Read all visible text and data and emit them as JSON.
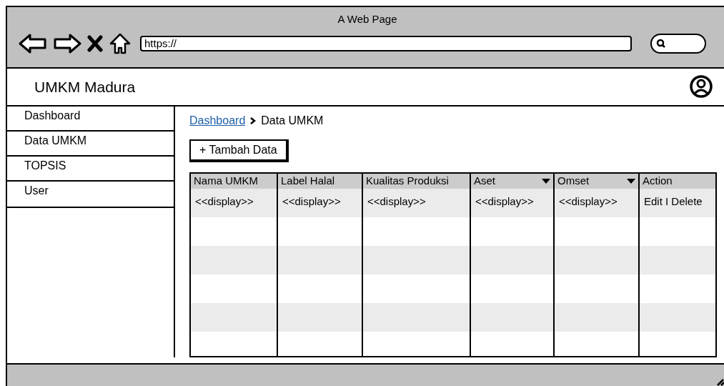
{
  "window": {
    "title": "A Web Page",
    "url": "https://"
  },
  "header": {
    "title": "UMKM Madura"
  },
  "sidebar": {
    "items": [
      {
        "label": "Dashboard"
      },
      {
        "label": "Data UMKM"
      },
      {
        "label": "TOPSIS"
      },
      {
        "label": "User"
      }
    ]
  },
  "breadcrumb": {
    "link": "Dashboard",
    "current": "Data UMKM"
  },
  "add_button": "+ Tambah Data",
  "table": {
    "columns": [
      {
        "label": "Nama UMKM",
        "kind": "text"
      },
      {
        "label": "Label Halal",
        "kind": "text"
      },
      {
        "label": "Kualitas Produksi",
        "kind": "text"
      },
      {
        "label": "Aset",
        "kind": "dropdown"
      },
      {
        "label": "Omset",
        "kind": "dropdown"
      },
      {
        "label": "Action",
        "kind": "text"
      }
    ],
    "rows": [
      [
        "<<display>>",
        "<<display>>",
        "<<display>>",
        "<<display>>",
        "<<display>>",
        "Edit I Delete"
      ]
    ]
  }
}
